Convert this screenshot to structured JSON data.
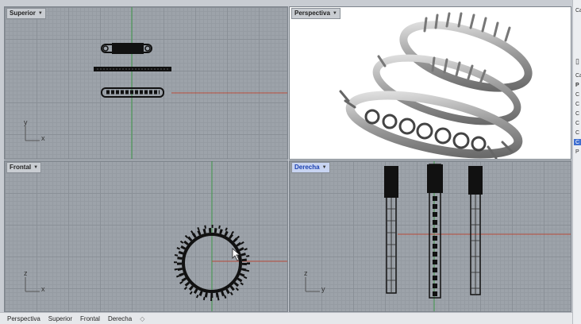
{
  "viewports": {
    "top": {
      "title": "Superior",
      "axis_v": "y",
      "axis_h": "x"
    },
    "perspective": {
      "title": "Perspectiva"
    },
    "front": {
      "title": "Frontal",
      "axis_v": "z",
      "axis_h": "x"
    },
    "right": {
      "title": "Derecha",
      "axis_v": "z",
      "axis_h": "y"
    }
  },
  "tabs": [
    "Perspectiva",
    "Superior",
    "Frontal",
    "Derecha"
  ],
  "tab_add_icon": "◇",
  "right_panel": {
    "header": "Ca",
    "items": [
      "Ca",
      "P",
      "C",
      "C",
      "C",
      "C",
      "C",
      "C",
      "P"
    ],
    "selected_index": 7
  },
  "colors": {
    "active_label": "#1a3fb0",
    "x_axis": "#b84b3a",
    "y_axis": "#3f9a4a",
    "selection": "#3f6fd1"
  }
}
